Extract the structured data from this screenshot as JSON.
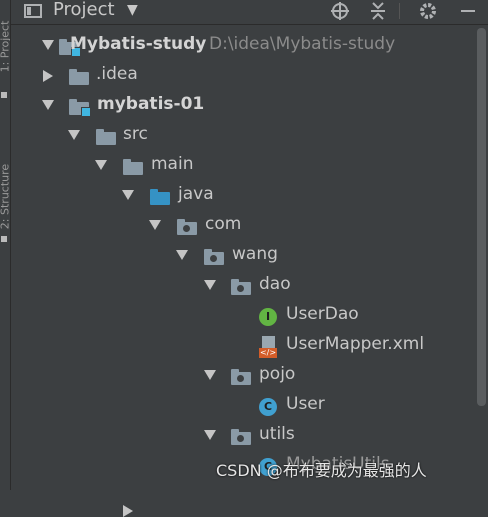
{
  "side_strip": {
    "labels": [
      "1: Project",
      "2: Structure"
    ]
  },
  "toolbar": {
    "title": "Project",
    "icons": [
      "project-view-icon",
      "dropdown-caret-icon",
      "locate-icon",
      "collapse-icon",
      "settings-icon",
      "minimize-icon"
    ]
  },
  "tree": {
    "root": {
      "name": "Mybatis-study",
      "path": "D:\\idea\\Mybatis-study"
    },
    "idea": "idea-folder",
    "idea_label": ".idea",
    "module": "mybatis-01",
    "src": "src",
    "main": "main",
    "java": "java",
    "com": "com",
    "wang": "wang",
    "dao": "dao",
    "user_dao": "UserDao",
    "user_mapper": "UserMapper.xml",
    "pojo": "pojo",
    "user": "User",
    "utils": "utils",
    "partial": "MybatisUtils"
  },
  "colors": {
    "background": "#3c3f41",
    "folder": "#8a9aa6",
    "source_folder": "#3592c4",
    "interface_icon": "#62b543",
    "class_icon": "#40a0d0",
    "xml_icon": "#d35d29"
  },
  "watermark": "CSDN @布布要成为最强的人"
}
